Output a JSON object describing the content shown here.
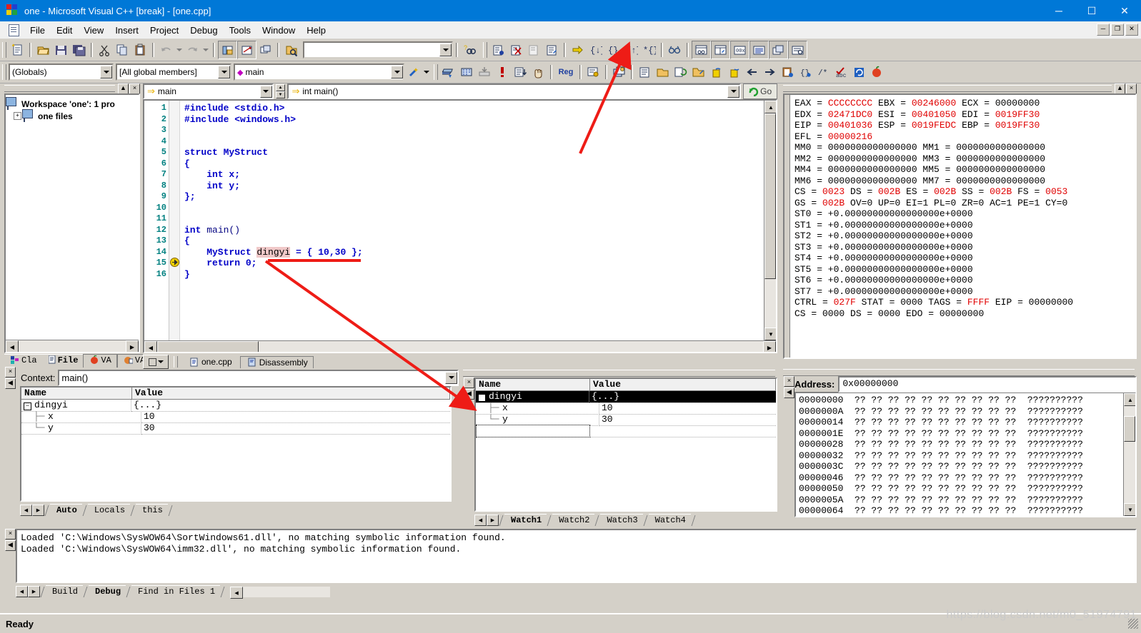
{
  "window": {
    "title": "one - Microsoft Visual C++ [break] - [one.cpp]",
    "minimize": "─",
    "maximize": "☐",
    "close": "✕",
    "doc_restore": "❐",
    "doc_minimize": "─",
    "doc_close": "✕"
  },
  "menu": {
    "items": [
      "File",
      "Edit",
      "View",
      "Insert",
      "Project",
      "Debug",
      "Tools",
      "Window",
      "Help"
    ]
  },
  "toolbar_standard": {
    "search_value": "",
    "icons": [
      "new-file-icon",
      "open-file-icon",
      "save-icon",
      "save-all-icon",
      "cut-icon",
      "copy-icon",
      "paste-icon",
      "undo-icon",
      "redo-icon",
      "workspace-icon",
      "output-window-icon",
      "window-list-icon",
      "find-in-files-icon",
      "help-search-icon"
    ]
  },
  "toolbar_wizardbar": {
    "class_combo": "(Globals)",
    "members_combo": "[All global members]",
    "function_combo": "main",
    "debug_icons": [
      "insert-breakpoint-icon",
      "remove-breakpoints-icon",
      "disable-breakpoint-icon",
      "edit-breakpoints-icon",
      "go-icon",
      "step-into-icon",
      "step-over-icon",
      "step-out-icon",
      "run-to-cursor-icon",
      "quickwatch-icon",
      "watch-window-icon",
      "variables-window-icon",
      "registers-window-icon",
      "memory-window-icon",
      "callstack-window-icon",
      "disassembly-window-icon"
    ],
    "build_icons": [
      "compile-icon",
      "build-icon",
      "stop-build-icon",
      "execute-icon",
      "go-debug-icon",
      "restart-icon",
      "registers-label",
      "settings-icon",
      "resource-icon"
    ],
    "reg_label": "Reg"
  },
  "workspace": {
    "root": "Workspace 'one': 1 pro",
    "child": "one files",
    "tabs": [
      {
        "label": "Cla",
        "icon": "classview-icon",
        "active": false
      },
      {
        "label": "File",
        "icon": "fileview-icon",
        "active": true
      },
      {
        "label": "VA",
        "icon": "va-view-icon",
        "active": false
      },
      {
        "label": "VA",
        "icon": "va-outline-icon",
        "active": false
      }
    ]
  },
  "editor": {
    "scope_combo": "main",
    "function_combo": "int main()",
    "go_button": "Go",
    "doc_tabs": [
      {
        "label": "one.cpp",
        "active": true
      },
      {
        "label": "Disassembly",
        "active": false
      }
    ],
    "lines": [
      {
        "n": "1",
        "tokens": [
          {
            "t": "#include ",
            "c": "kw"
          },
          {
            "t": "<stdio.h>",
            "c": "kw"
          }
        ]
      },
      {
        "n": "2",
        "tokens": [
          {
            "t": "#include ",
            "c": "kw"
          },
          {
            "t": "<windows.h>",
            "c": "kw"
          }
        ]
      },
      {
        "n": "3",
        "tokens": []
      },
      {
        "n": "4",
        "tokens": []
      },
      {
        "n": "5",
        "tokens": [
          {
            "t": "struct ",
            "c": "kw"
          },
          {
            "t": "MyStruct",
            "c": "kw"
          }
        ]
      },
      {
        "n": "6",
        "tokens": [
          {
            "t": "{",
            "c": "kw"
          }
        ]
      },
      {
        "n": "7",
        "tokens": [
          {
            "t": "    int ",
            "c": "kw"
          },
          {
            "t": "x;",
            "c": "kw"
          }
        ]
      },
      {
        "n": "8",
        "tokens": [
          {
            "t": "    int ",
            "c": "kw"
          },
          {
            "t": "y;",
            "c": "kw"
          }
        ]
      },
      {
        "n": "9",
        "tokens": [
          {
            "t": "};",
            "c": "kw"
          }
        ]
      },
      {
        "n": "10",
        "tokens": []
      },
      {
        "n": "11",
        "tokens": []
      },
      {
        "n": "12",
        "tokens": [
          {
            "t": "int ",
            "c": "kw"
          },
          {
            "t": "main()",
            "c": "cd-dark"
          }
        ]
      },
      {
        "n": "13",
        "tokens": [
          {
            "t": "{",
            "c": "kw"
          }
        ]
      },
      {
        "n": "14",
        "tokens": [
          {
            "t": "    MyStruct ",
            "c": "kw"
          },
          {
            "t": "dingyi",
            "c": "sel"
          },
          {
            "t": " = { 10,30 };",
            "c": "kw"
          }
        ]
      },
      {
        "n": "15",
        "tokens": [
          {
            "t": "    return ",
            "c": "kw"
          },
          {
            "t": "0;",
            "c": "kw"
          }
        ],
        "breakpoint_arrow": true
      },
      {
        "n": "16",
        "tokens": [
          {
            "t": "}",
            "c": "kw"
          }
        ]
      }
    ]
  },
  "registers": {
    "lines": [
      [
        {
          "t": "EAX = ",
          "r": false
        },
        {
          "t": "CCCCCCCC",
          "r": true
        },
        {
          "t": " EBX = ",
          "r": false
        },
        {
          "t": "00246000",
          "r": true
        },
        {
          "t": " ECX = ",
          "r": false
        },
        {
          "t": "00000000",
          "r": false
        }
      ],
      [
        {
          "t": "EDX = ",
          "r": false
        },
        {
          "t": "02471DC0",
          "r": true
        },
        {
          "t": " ESI = ",
          "r": false
        },
        {
          "t": "00401050",
          "r": true
        },
        {
          "t": " EDI = ",
          "r": false
        },
        {
          "t": "0019FF30",
          "r": true
        }
      ],
      [
        {
          "t": "EIP = ",
          "r": false
        },
        {
          "t": "00401036",
          "r": true
        },
        {
          "t": " ESP = ",
          "r": false
        },
        {
          "t": "0019FEDC",
          "r": true
        },
        {
          "t": " EBP = ",
          "r": false
        },
        {
          "t": "0019FF30",
          "r": true
        }
      ],
      [
        {
          "t": "EFL = ",
          "r": false
        },
        {
          "t": "00000216",
          "r": true
        }
      ],
      [
        {
          "t": "MM0 = 0000000000000000 MM1 = 0000000000000000",
          "r": false
        }
      ],
      [
        {
          "t": "MM2 = 0000000000000000 MM3 = 0000000000000000",
          "r": false
        }
      ],
      [
        {
          "t": "MM4 = 0000000000000000 MM5 = 0000000000000000",
          "r": false
        }
      ],
      [
        {
          "t": "MM6 = 0000000000000000 MM7 = 0000000000000000",
          "r": false
        }
      ],
      [
        {
          "t": "CS = ",
          "r": false
        },
        {
          "t": "0023",
          "r": true
        },
        {
          "t": " DS = ",
          "r": false
        },
        {
          "t": "002B",
          "r": true
        },
        {
          "t": " ES = ",
          "r": false
        },
        {
          "t": "002B",
          "r": true
        },
        {
          "t": " SS = ",
          "r": false
        },
        {
          "t": "002B",
          "r": true
        },
        {
          "t": " FS = ",
          "r": false
        },
        {
          "t": "0053",
          "r": true
        }
      ],
      [
        {
          "t": "GS = ",
          "r": false
        },
        {
          "t": "002B",
          "r": true
        },
        {
          "t": " OV=0 UP=0 EI=1 PL=0 ZR=0 AC=1 PE=1 CY=0",
          "r": false
        }
      ],
      [
        {
          "t": "ST0 = +0.00000000000000000e+0000",
          "r": false
        }
      ],
      [
        {
          "t": "ST1 = +0.00000000000000000e+0000",
          "r": false
        }
      ],
      [
        {
          "t": "ST2 = +0.00000000000000000e+0000",
          "r": false
        }
      ],
      [
        {
          "t": "ST3 = +0.00000000000000000e+0000",
          "r": false
        }
      ],
      [
        {
          "t": "ST4 = +0.00000000000000000e+0000",
          "r": false
        }
      ],
      [
        {
          "t": "ST5 = +0.00000000000000000e+0000",
          "r": false
        }
      ],
      [
        {
          "t": "ST6 = +0.00000000000000000e+0000",
          "r": false
        }
      ],
      [
        {
          "t": "ST7 = +0.00000000000000000e+0000",
          "r": false
        }
      ],
      [
        {
          "t": "CTRL = ",
          "r": false
        },
        {
          "t": "027F",
          "r": true
        },
        {
          "t": " STAT = 0000 TAGS = ",
          "r": false
        },
        {
          "t": "FFFF",
          "r": true
        },
        {
          "t": " EIP = 00000000",
          "r": false
        }
      ],
      [
        {
          "t": "CS = 0000 DS = 0000 EDO = 00000000",
          "r": false
        }
      ]
    ]
  },
  "variables": {
    "context_label": "Context:",
    "context_value": "main()",
    "columns": [
      "Name",
      "Value"
    ],
    "rows": [
      {
        "indent": 0,
        "expander": "minus",
        "name": "dingyi",
        "value": "{...}"
      },
      {
        "indent": 1,
        "expander": "tee",
        "name": "x",
        "value": "10"
      },
      {
        "indent": 1,
        "expander": "ell",
        "name": "y",
        "value": "30"
      }
    ],
    "tabs": [
      {
        "label": "Auto",
        "active": true
      },
      {
        "label": "Locals",
        "active": false
      },
      {
        "label": "this",
        "active": false
      }
    ]
  },
  "watch": {
    "columns": [
      "Name",
      "Value"
    ],
    "rows": [
      {
        "indent": 0,
        "expander": "minus",
        "name": "dingyi",
        "value": "{...}",
        "selected": true
      },
      {
        "indent": 1,
        "expander": "tee",
        "name": "x",
        "value": "10",
        "selected": false
      },
      {
        "indent": 1,
        "expander": "ell",
        "name": "y",
        "value": "30",
        "selected": false
      },
      {
        "indent": 0,
        "expander": "none",
        "name": "",
        "value": "",
        "selected": false,
        "editing": true
      }
    ],
    "tabs": [
      {
        "label": "Watch1",
        "active": true
      },
      {
        "label": "Watch2",
        "active": false
      },
      {
        "label": "Watch3",
        "active": false
      },
      {
        "label": "Watch4",
        "active": false
      }
    ]
  },
  "memory": {
    "address_label": "Address:",
    "address_value": "0x00000000",
    "rows": [
      {
        "addr": "00000000",
        "bytes": "?? ?? ?? ?? ?? ?? ?? ?? ?? ??",
        "ascii": "??????????"
      },
      {
        "addr": "0000000A",
        "bytes": "?? ?? ?? ?? ?? ?? ?? ?? ?? ??",
        "ascii": "??????????"
      },
      {
        "addr": "00000014",
        "bytes": "?? ?? ?? ?? ?? ?? ?? ?? ?? ??",
        "ascii": "??????????"
      },
      {
        "addr": "0000001E",
        "bytes": "?? ?? ?? ?? ?? ?? ?? ?? ?? ??",
        "ascii": "??????????"
      },
      {
        "addr": "00000028",
        "bytes": "?? ?? ?? ?? ?? ?? ?? ?? ?? ??",
        "ascii": "??????????"
      },
      {
        "addr": "00000032",
        "bytes": "?? ?? ?? ?? ?? ?? ?? ?? ?? ??",
        "ascii": "??????????"
      },
      {
        "addr": "0000003C",
        "bytes": "?? ?? ?? ?? ?? ?? ?? ?? ?? ??",
        "ascii": "??????????"
      },
      {
        "addr": "00000046",
        "bytes": "?? ?? ?? ?? ?? ?? ?? ?? ?? ??",
        "ascii": "??????????"
      },
      {
        "addr": "00000050",
        "bytes": "?? ?? ?? ?? ?? ?? ?? ?? ?? ??",
        "ascii": "??????????"
      },
      {
        "addr": "0000005A",
        "bytes": "?? ?? ?? ?? ?? ?? ?? ?? ?? ??",
        "ascii": "??????????"
      },
      {
        "addr": "00000064",
        "bytes": "?? ?? ?? ?? ?? ?? ?? ?? ?? ??",
        "ascii": "??????????"
      }
    ]
  },
  "output": {
    "lines": [
      "Loaded 'C:\\Windows\\SysWOW64\\SortWindows61.dll', no matching symbolic information found.",
      "Loaded 'C:\\Windows\\SysWOW64\\imm32.dll', no matching symbolic information found."
    ],
    "tabs": [
      {
        "label": "Build",
        "active": false
      },
      {
        "label": "Debug",
        "active": true
      },
      {
        "label": "Find in Files 1",
        "active": false
      }
    ]
  },
  "statusbar": {
    "text": "Ready"
  },
  "watermark": "https://blog.csdn.net/m0_51974791",
  "colors": {
    "title_blue": "#0078d7",
    "face": "#d4d0c8",
    "keyword_blue": "#0000c8",
    "register_red": "#e00000",
    "annotation_red": "#ee1c16",
    "gutter_teal": "#008080"
  }
}
